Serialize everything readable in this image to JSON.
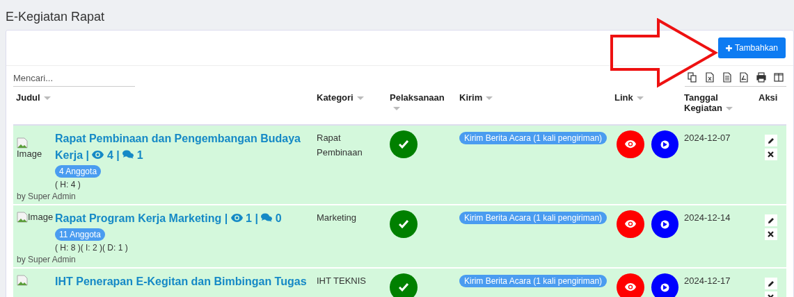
{
  "page_title": "E-Kegiatan Rapat",
  "add_button": {
    "label": "Tambahkan"
  },
  "search": {
    "placeholder": "Mencari..."
  },
  "table": {
    "separator": "|",
    "columns": [
      {
        "label": "Judul",
        "sortable": true
      },
      {
        "label": "Kategori",
        "sortable": true
      },
      {
        "label": "Pelaksanaan",
        "sortable": true
      },
      {
        "label": "Kirim",
        "sortable": true
      },
      {
        "label": "Link",
        "sortable": true
      },
      {
        "label": "Tanggal Kegiatan",
        "sortable": true
      },
      {
        "label": "Aksi",
        "sortable": false
      }
    ],
    "rows": [
      {
        "image_alt": "Image",
        "image_stacked": true,
        "title": "Rapat Pembinaan dan Pengembangan Budaya Kerja",
        "views": "4",
        "comments": "1",
        "members": "4 Anggota",
        "attendance": [
          "( H: 4 )"
        ],
        "author": "by Super Admin",
        "category": "Rapat Pembinaan",
        "done": true,
        "send": "Kirim Berita Acara (1 kali pengiriman)",
        "date": "2024-12-07"
      },
      {
        "image_alt": "Image",
        "image_stacked": false,
        "title": "Rapat Program Kerja Marketing",
        "views": "1",
        "comments": "0",
        "members": "11 Anggota",
        "attendance": [
          "( H: 8 )",
          "( I: 2 )",
          "( D: 1 )"
        ],
        "author": "by Super Admin",
        "category": "Marketing",
        "done": true,
        "send": "Kirim Berita Acara (1 kali pengiriman)",
        "date": "2024-12-14"
      },
      {
        "image_alt": "",
        "image_stacked": false,
        "title": "IHT Penerapan E-Kegitan dan Bimbingan Tugas",
        "category": "IHT TEKNIS",
        "done": true,
        "send": "Kirim Berita Acara (1 kali pengiriman)",
        "date": "2024-12-17"
      }
    ]
  }
}
